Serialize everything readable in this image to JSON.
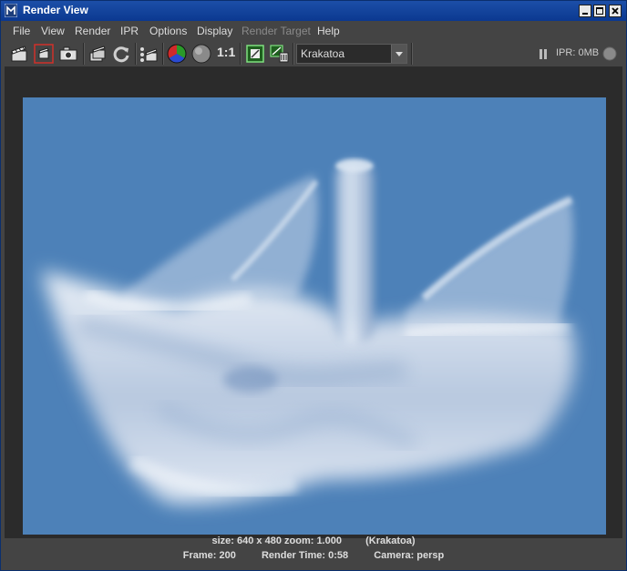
{
  "window": {
    "title": "Render View"
  },
  "menu": [
    "File",
    "View",
    "Render",
    "IPR",
    "Options",
    "Display",
    "Render Target",
    "Help"
  ],
  "toolbar": {
    "ratio_label": "1:1",
    "renderer_select": "Krakatoa",
    "ipr_status": "IPR: 0MB"
  },
  "status": {
    "size_zoom": "size: 640 x 480 zoom: 1.000",
    "renderer": "(Krakatoa)",
    "frame": "Frame: 200",
    "render_time": "Render Time: 0:58",
    "camera": "Camera: persp"
  },
  "colors": {
    "titlebar": "#0b3890",
    "background": "#444444",
    "canvas_background": "#4d81b8"
  }
}
